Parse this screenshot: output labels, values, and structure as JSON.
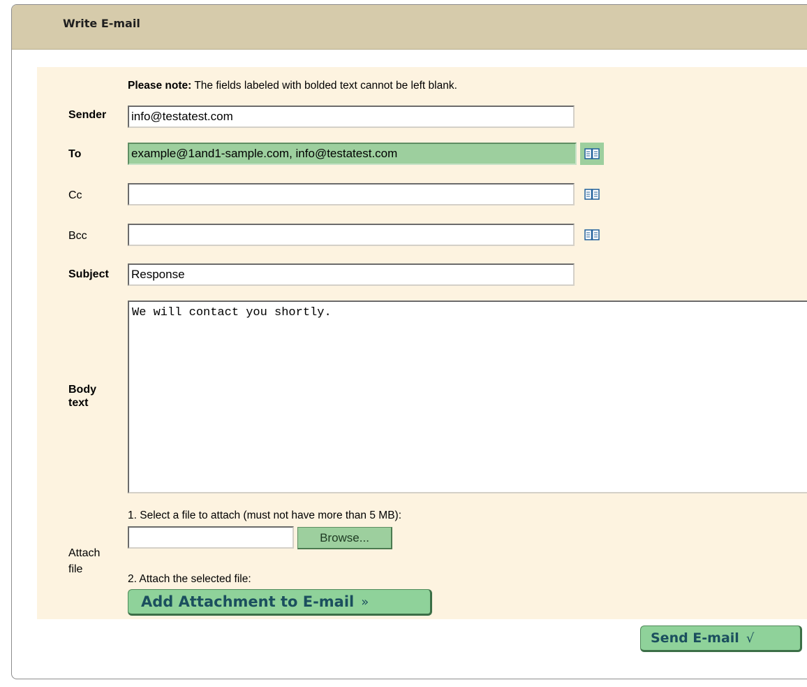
{
  "header": {
    "title": "Write E-mail"
  },
  "note": {
    "bold": "Please note:",
    "text": " The fields labeled with bolded text cannot be left blank."
  },
  "fields": {
    "sender": {
      "label": "Sender",
      "value": "info@testatest.com"
    },
    "to": {
      "label": "To",
      "value": "example@1and1-sample.com, info@testatest.com"
    },
    "cc": {
      "label": "Cc",
      "value": ""
    },
    "bcc": {
      "label": "Bcc",
      "value": ""
    },
    "subject": {
      "label": "Subject",
      "value": "Response"
    }
  },
  "body": {
    "label_line1": "Body",
    "label_line2": "text",
    "value": "We will contact you shortly."
  },
  "attach": {
    "label_line1": "Attach",
    "label_line2": "file",
    "step1": "1. Select a file to attach (must not have more than 5 MB):",
    "browse_label": "Browse...",
    "step2": "2. Attach the selected file:",
    "add_button": "Add Attachment to E-mail",
    "add_button_glyph": "»"
  },
  "send": {
    "label": "Send E-mail",
    "glyph": "√"
  },
  "icons": {
    "address_book": "address-book-icon"
  },
  "colors": {
    "header_bg": "#d6cbab",
    "form_bg": "#fdf3e0",
    "button_green": "#8fd29a",
    "highlight_green": "#9dcf9e"
  }
}
